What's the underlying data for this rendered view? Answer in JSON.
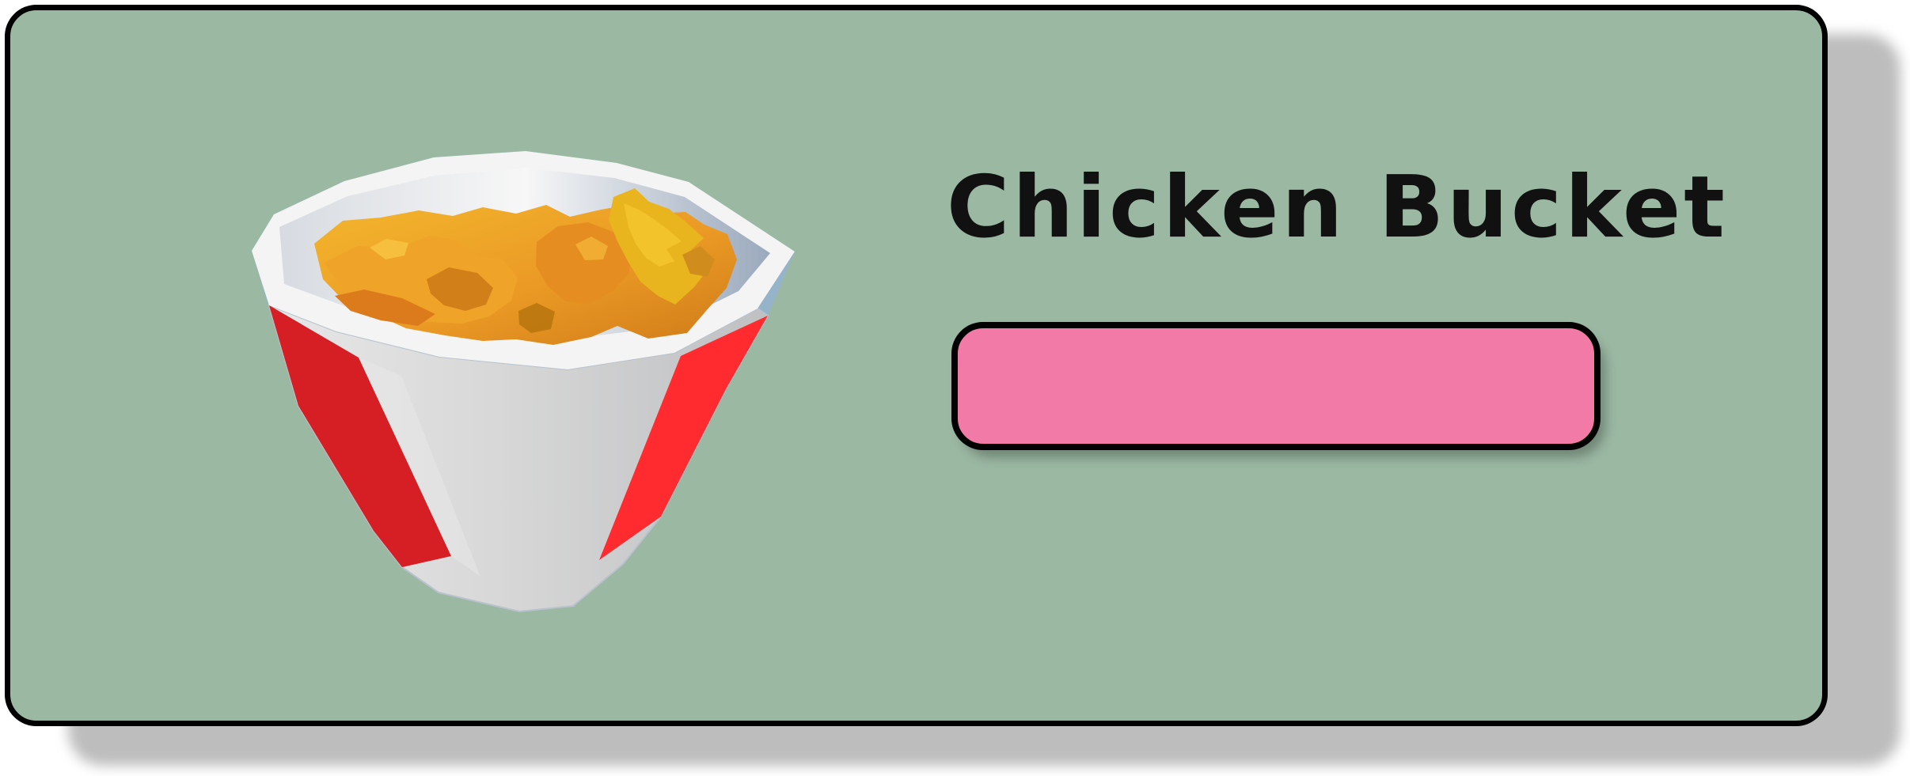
{
  "card": {
    "title": "Chicken Bucket",
    "image": "chicken-bucket-icon",
    "background_color": "#9bb8a3",
    "button_color": "#f27aa6"
  },
  "action_button": {
    "label": ""
  }
}
